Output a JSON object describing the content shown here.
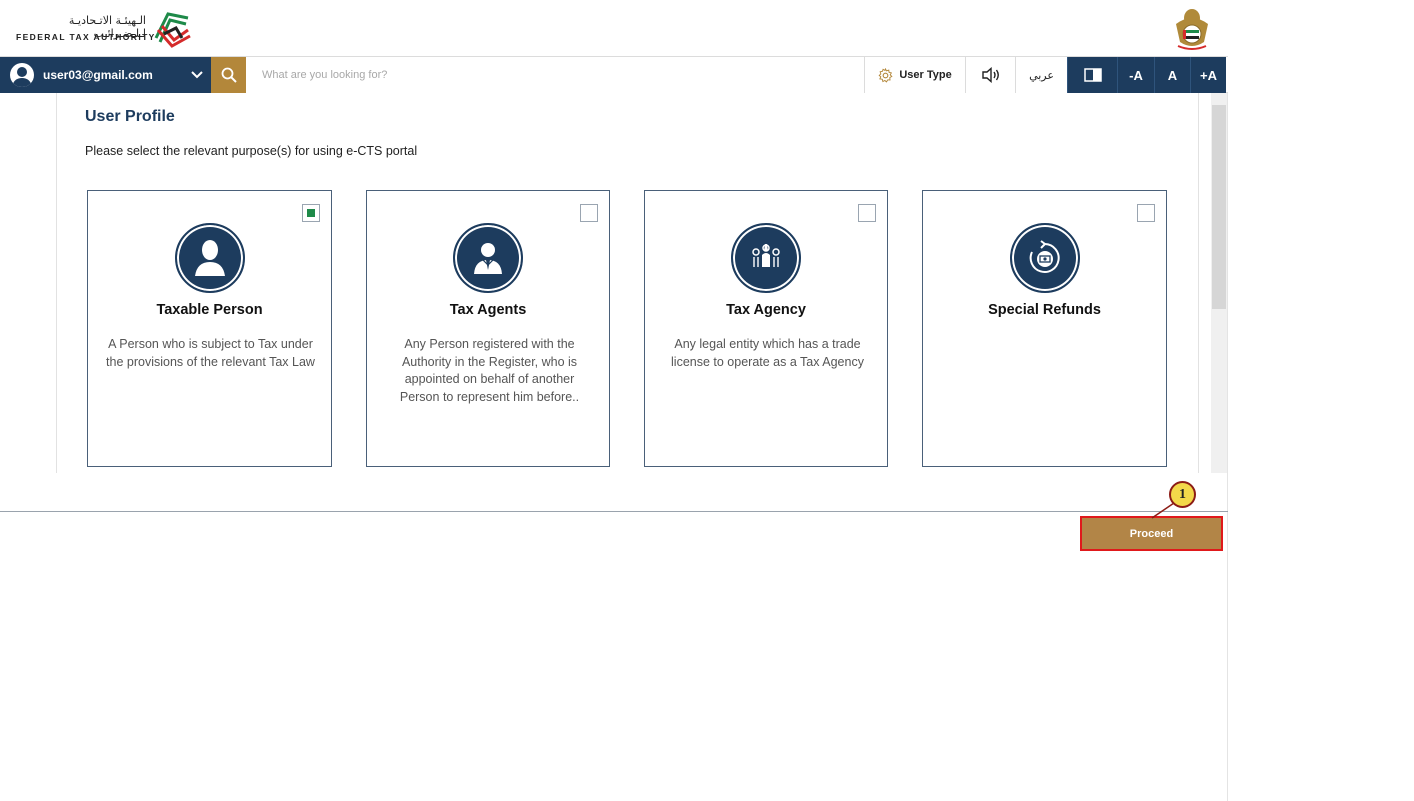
{
  "header": {
    "logo_arabic": "الـهيئـة الاتـحاديـة لـلـضـرائـب",
    "logo_english": "FEDERAL TAX AUTHORITY"
  },
  "toolbar": {
    "user_email": "user03@gmail.com",
    "search_placeholder": "What are you looking for?",
    "user_type_label": "User Type",
    "arabic_label": "عربي",
    "font_decrease_label": "-A",
    "font_reset_label": "A",
    "font_increase_label": "+A"
  },
  "main": {
    "title": "User Profile",
    "subtitle": "Please select the relevant purpose(s) for using e-CTS portal",
    "cards": [
      {
        "title": "Taxable Person",
        "description": "A Person who is subject to Tax under the provisions of the relevant Tax Law",
        "checked": true,
        "icon": "person-silhouette-icon"
      },
      {
        "title": "Tax Agents",
        "description": "Any Person registered with the Authority in the Register, who is appointed on behalf of another Person to represent him before..",
        "checked": false,
        "icon": "agent-icon"
      },
      {
        "title": "Tax Agency",
        "description": "Any legal entity which has a trade license to operate as a Tax Agency",
        "checked": false,
        "icon": "agency-icon"
      },
      {
        "title": "Special Refunds",
        "description": "",
        "checked": false,
        "icon": "refund-icon"
      }
    ]
  },
  "footer": {
    "proceed_label": "Proceed"
  },
  "annotation": {
    "callout_number": "1"
  },
  "colors": {
    "navy": "#1d3c5e",
    "gold": "#b3873a",
    "check_green": "#1e8a49",
    "highlight_red": "#e0191b"
  }
}
